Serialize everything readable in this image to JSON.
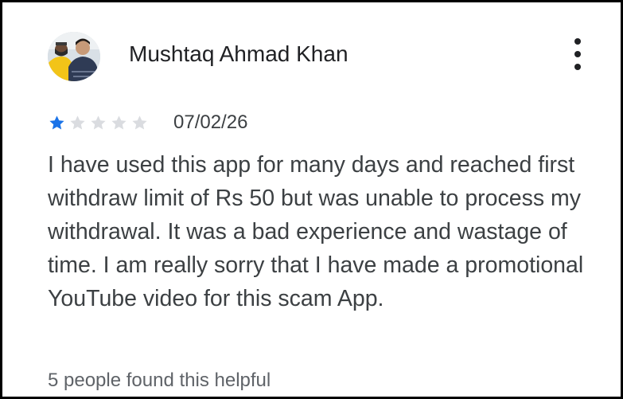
{
  "review": {
    "author_name": "Mushtaq Ahmad Khan",
    "avatar_icon": "profile-photo",
    "menu_icon": "more-vert-icon",
    "rating": 1,
    "rating_max": 5,
    "date": "07/02/26",
    "text": "I have used this app for many days and reached first withdraw limit of Rs 50 but was unable to process my withdrawal. It was a bad experience and wastage of time. I am really sorry that I have made a promotional YouTube video for this scam App.",
    "helpful_text": "5 people found this helpful"
  },
  "colors": {
    "star_filled": "#1a73e8",
    "star_empty": "#dadce0",
    "frame_border": "#000000"
  }
}
